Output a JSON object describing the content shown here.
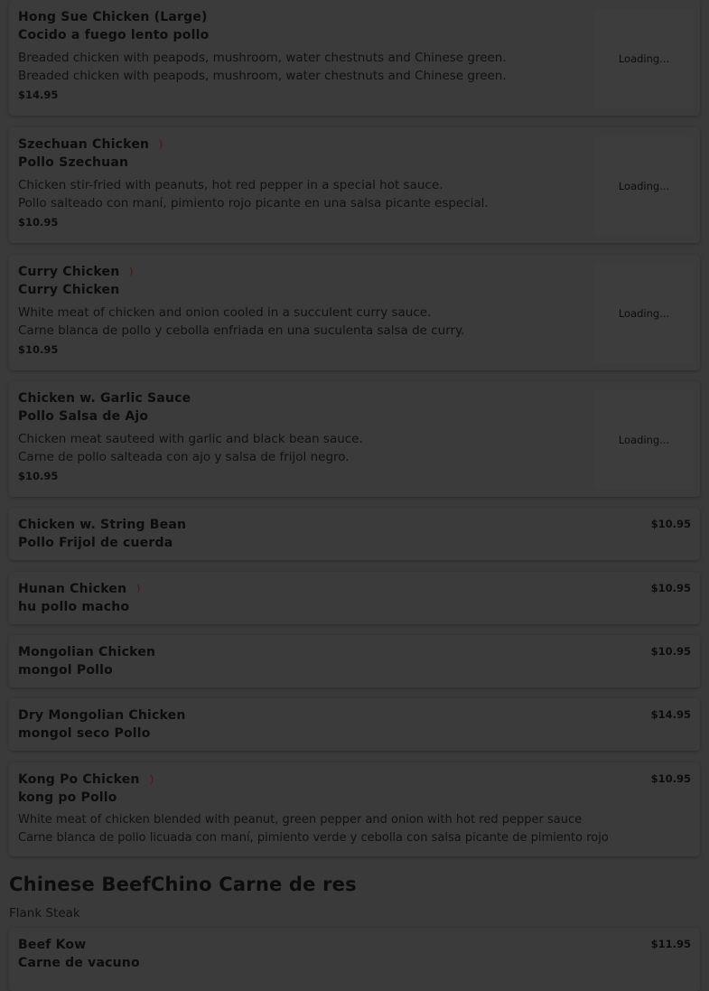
{
  "colors": {
    "overlay_bg": "#3a3a3a",
    "card_bg": "#3b3b3b",
    "text": "#0c0c0c",
    "chili": "#5a1010"
  },
  "loading_label": "Loading...",
  "items": [
    {
      "name_en": "Hong Sue Chicken (Large)",
      "name_es": "Cocido a fuego lento pollo",
      "desc_1": "Breaded chicken with peapods, mushroom, water chestnuts and Chinese green.",
      "desc_2": "Breaded chicken with peapods, mushroom, water chestnuts and Chinese green.",
      "price": "$14.95",
      "spicy": false
    },
    {
      "name_en": "Szechuan Chicken",
      "name_es": "Pollo Szechuan",
      "desc_1": "Chicken stir-fried with peanuts, hot red pepper in a special hot sauce.",
      "desc_2": "Pollo salteado con maní, pimiento rojo picante en una salsa picante especial.",
      "price": "$10.95",
      "spicy": true
    },
    {
      "name_en": "Curry Chicken",
      "name_es": "Curry Chicken",
      "desc_1": "White meat of chicken and onion cooled in a succulent curry sauce.",
      "desc_2": "Carne blanca de pollo y cebolla enfriada en una suculenta salsa de curry.",
      "price": "$10.95",
      "spicy": true
    },
    {
      "name_en": "Chicken w. Garlic Sauce",
      "name_es": "Pollo Salsa de Ajo",
      "desc_1": "Chicken meat sauteed with garlic and black bean sauce.",
      "desc_2": "Carne de pollo salteada con ajo y salsa de frijol negro.",
      "price": "$10.95",
      "spicy": false
    },
    {
      "name_en": "Chicken w. String Bean",
      "name_es": "Pollo Frijol de cuerda",
      "price": "$10.95",
      "spicy": false
    },
    {
      "name_en": "Hunan Chicken",
      "name_es": "hu pollo macho",
      "price": "$10.95",
      "spicy": true
    },
    {
      "name_en": "Mongolian Chicken",
      "name_es": "mongol Pollo",
      "price": "$10.95",
      "spicy": false
    },
    {
      "name_en": "Dry Mongolian Chicken",
      "name_es": "mongol seco Pollo",
      "price": "$14.95",
      "spicy": false
    },
    {
      "name_en": "Kong Po Chicken",
      "name_es": "kong po Pollo",
      "desc_1": "White meat of chicken blended with peanut, green pepper and onion with hot red pepper sauce",
      "desc_2": "Carne blanca de pollo licuada con maní, pimiento verde y cebolla con salsa picante de pimiento rojo",
      "price": "$10.95",
      "spicy": true
    },
    {
      "name_en": "Beef Kow",
      "name_es": "Carne de vacuno",
      "price": "$11.95",
      "spicy": false
    }
  ],
  "section": {
    "title": "Chinese BeefChino Carne de res",
    "subtitle": "Flank Steak"
  }
}
